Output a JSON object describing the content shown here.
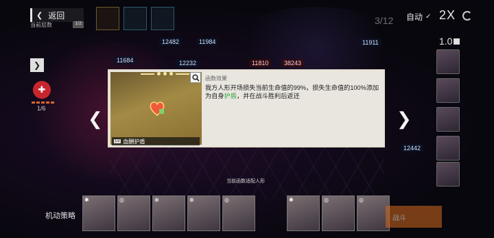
{
  "header": {
    "back_label": "返回",
    "current_layer_label": "当前层数",
    "current_layer_value": "1/2",
    "round_counter": "3/12",
    "auto_label": "自动",
    "speed_label": "2X",
    "version_label": "1.0"
  },
  "left_panel": {
    "item_count": "1/6"
  },
  "hp_values": {
    "a": "12482",
    "b": "11984",
    "c": "11684",
    "d": "12232",
    "e": "11810",
    "f": "38243",
    "g": "11911",
    "h": "12442"
  },
  "modal": {
    "section_title": "函数效果",
    "description_part1": "我方人形开场损失当前生命值的99%，损失生命值的100%添加为自身",
    "description_highlight": "护盾",
    "description_part2": "，并在战斗胜利后返还",
    "item_name": "血酬护盾",
    "item_level": "Lv"
  },
  "caption": "当前函数适配人形",
  "bottom": {
    "strategy_label": "机动策略",
    "start_label": "战斗"
  },
  "colors": {
    "accent_highlight": "#3aa54b",
    "start_button": "#d46a1e",
    "item_icon": "#c8262d"
  }
}
